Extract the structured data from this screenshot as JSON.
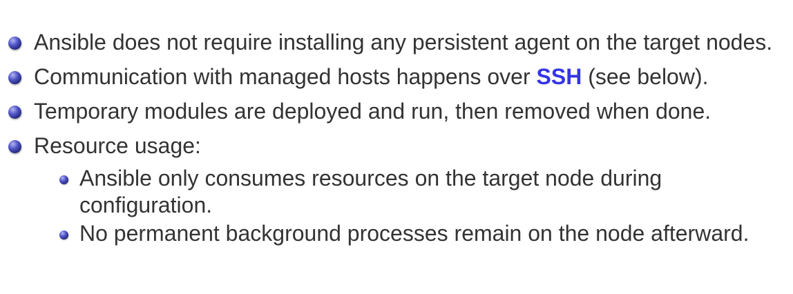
{
  "bullets": {
    "item1": {
      "text": "Ansible does not require installing any persistent agent on the target nodes."
    },
    "item2": {
      "before": "Communication with managed hosts happens over ",
      "highlight": "SSH",
      "after": " (see below)."
    },
    "item3": {
      "text": "Temporary modules are deployed and run, then removed when done."
    },
    "item4": {
      "text": "Resource usage:",
      "subitems": [
        "Ansible only consumes resources on the target node during configuration.",
        "No permanent background processes remain on the node afterward."
      ]
    }
  },
  "colors": {
    "text": "#333333",
    "highlight": "#3434e6",
    "bullet": "#2b2e9c"
  }
}
